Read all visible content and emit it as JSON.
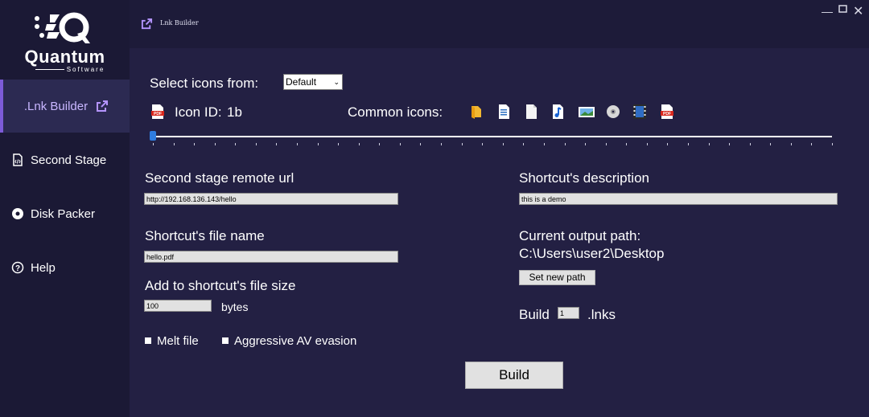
{
  "app": {
    "logo_name": "Quantum",
    "logo_sub": "Software",
    "window_title": "Lnk Builder"
  },
  "sidebar": {
    "items": [
      {
        "label": ".Lnk Builder",
        "icon": "external-link-icon",
        "active": true
      },
      {
        "label": "Second Stage",
        "icon": "code-file-icon"
      },
      {
        "label": "Disk Packer",
        "icon": "disc-icon"
      },
      {
        "label": "Help",
        "icon": "question-circle-icon"
      }
    ]
  },
  "icons_section": {
    "select_label": "Select icons from:",
    "select_value": "Default",
    "icon_id_label": "Icon ID:",
    "icon_id_value": "1b",
    "common_label": "Common icons:",
    "common_icons": [
      "folder-icon",
      "document-icon",
      "blank-page-icon",
      "music-icon",
      "image-icon",
      "disc-icon",
      "video-icon",
      "pdf-icon"
    ]
  },
  "slider": {
    "value": 0
  },
  "form": {
    "remote_url_label": "Second stage remote url",
    "remote_url_value": "http://192.168.136.143/hello",
    "file_name_label": "Shortcut's file name",
    "file_name_value": "hello.pdf",
    "size_label": "Add to shortcut's file size",
    "size_value": "100",
    "size_unit": "bytes",
    "melt_label": "Melt file",
    "av_label": "Aggressive AV evasion",
    "description_label": "Shortcut's description",
    "description_value": "this is a demo",
    "output_label": "Current output path:",
    "output_path": "C:\\Users\\user2\\Desktop",
    "set_path_button": "Set new path",
    "build_count_prefix": "Build",
    "build_count_value": "1",
    "build_count_suffix": ".lnks",
    "build_button": "Build"
  },
  "colors": {
    "background": "#232043",
    "sidebar": "#1b1935",
    "accent": "#7d5bd8"
  }
}
